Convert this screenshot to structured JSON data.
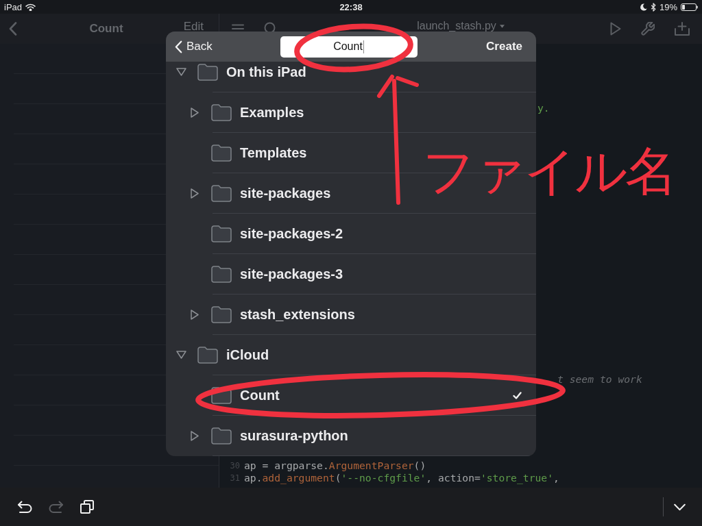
{
  "status_bar": {
    "device": "iPad",
    "time": "22:38",
    "battery": "19%"
  },
  "sidebar": {
    "title": "Count",
    "edit": "Edit"
  },
  "editor": {
    "title": "launch_stash.py",
    "fragments": [
      {
        "text": "y.",
        "kind": "string"
      },
      {
        "text": "t seem to work",
        "kind": "comment"
      }
    ],
    "lines": [
      {
        "number": "30",
        "tokens": [
          {
            "text": "ap = argparse.",
            "kind": "plain"
          },
          {
            "text": "ArgumentParser",
            "kind": "function"
          },
          {
            "text": "()",
            "kind": "plain"
          }
        ]
      },
      {
        "number": "31",
        "tokens": [
          {
            "text": "ap.",
            "kind": "plain"
          },
          {
            "text": "add_argument",
            "kind": "function"
          },
          {
            "text": "(",
            "kind": "plain"
          },
          {
            "text": "'--no-cfgfile'",
            "kind": "string"
          },
          {
            "text": ", action=",
            "kind": "plain"
          },
          {
            "text": "'store_true'",
            "kind": "string"
          },
          {
            "text": ",",
            "kind": "plain"
          }
        ]
      }
    ]
  },
  "toolbar": {
    "buttons": [
      {
        "kind": "undo",
        "disabled": false
      },
      {
        "kind": "redo",
        "disabled": true
      },
      {
        "kind": "copy",
        "disabled": false
      }
    ]
  },
  "dialog": {
    "back": "Back",
    "name_field": {
      "value": "Count"
    },
    "create": "Create",
    "tree": [
      {
        "name": "On this iPad",
        "expandable": true,
        "expanded": true,
        "selected": false,
        "children": [
          {
            "name": "Examples",
            "expandable": true,
            "expanded": false,
            "selected": false
          },
          {
            "name": "Templates",
            "expandable": false,
            "selected": false
          },
          {
            "name": "site-packages",
            "expandable": true,
            "expanded": false,
            "selected": false
          },
          {
            "name": "site-packages-2",
            "expandable": false,
            "selected": false
          },
          {
            "name": "site-packages-3",
            "expandable": false,
            "selected": false
          },
          {
            "name": "stash_extensions",
            "expandable": true,
            "expanded": false,
            "selected": false
          }
        ]
      },
      {
        "name": "iCloud",
        "expandable": true,
        "expanded": true,
        "selected": false,
        "children": [
          {
            "name": "Count",
            "expandable": false,
            "selected": true
          },
          {
            "name": "surasura-python",
            "expandable": true,
            "expanded": false,
            "selected": false
          }
        ]
      }
    ]
  },
  "annotation": {
    "note": "ファイル名"
  }
}
